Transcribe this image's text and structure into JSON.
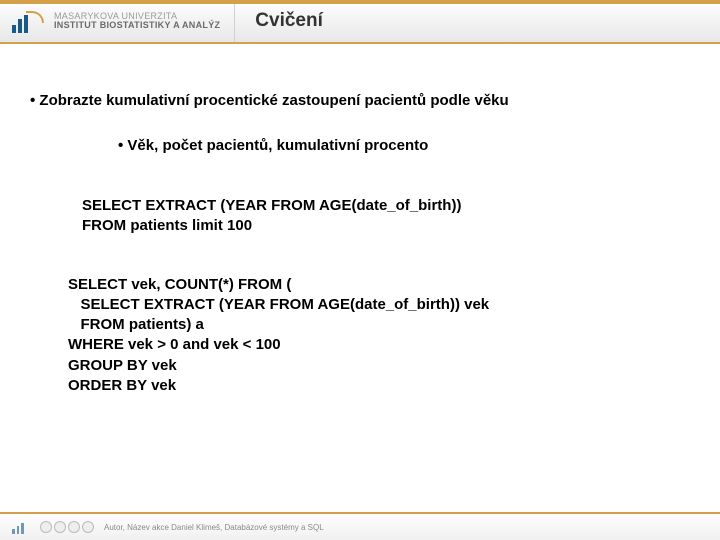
{
  "header": {
    "university": "MASARYKOVA UNIVERZITA",
    "institute": "INSTITUT BIOSTATISTIKY A ANALÝZ",
    "title": "Cvičení"
  },
  "content": {
    "bullet1": "• Zobrazte kumulativní procentické zastoupení pacientů podle věku",
    "bullet2": "• Věk, počet pacientů, kumulativní procento",
    "code1": "SELECT EXTRACT (YEAR FROM AGE(date_of_birth))\nFROM patients limit 100",
    "code2": "SELECT vek, COUNT(*) FROM (\n   SELECT EXTRACT (YEAR FROM AGE(date_of_birth)) vek\n   FROM patients) a\nWHERE vek > 0 and vek < 100\nGROUP BY vek\nORDER BY vek"
  },
  "footer": {
    "text": "Autor, Název akce   Daniel Klimeš, Databázové systémy a SQL"
  }
}
